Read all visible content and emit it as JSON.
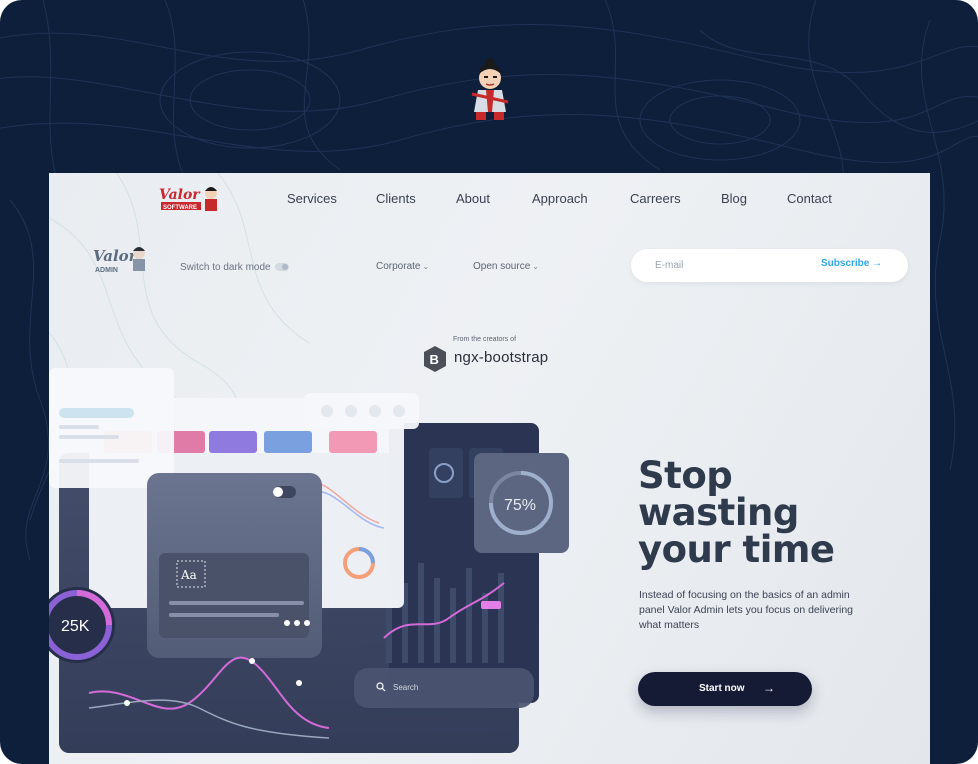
{
  "nav": {
    "items": [
      "Services",
      "Clients",
      "About",
      "Approach",
      "Carreers",
      "Blog",
      "Contact"
    ]
  },
  "toolbar": {
    "dark_mode_label": "Switch to dark mode",
    "dropdowns": [
      "Corporate",
      "Open source"
    ]
  },
  "subscribe": {
    "placeholder": "E-mail",
    "button_label": "Subscribe →"
  },
  "creators": {
    "caption": "From the creators of",
    "name": "ngx-bootstrap"
  },
  "hero": {
    "headline": "Stop wasting your time",
    "subtext": "Instead of focusing on the basics of an admin panel Valor Admin lets you focus on delivering what matters",
    "cta_label": "Start now",
    "cta_arrow": "→"
  },
  "mockup": {
    "stat_left": "25K",
    "stat_right": "75%",
    "search_placeholder": "Search",
    "card_aa": "Aa"
  },
  "logos": {
    "brand": "Valor Software",
    "admin": "Valor Admin"
  },
  "colors": {
    "frame_bg": "#0e1f3b",
    "accent_blue": "#2ea6e6",
    "cta_bg": "#161b35",
    "headline": "#2f3a4c"
  },
  "icons": [
    "samurai-mascot-icon",
    "bootstrap-logo-icon",
    "chevron-down-icon",
    "arrow-right-icon",
    "search-icon"
  ]
}
